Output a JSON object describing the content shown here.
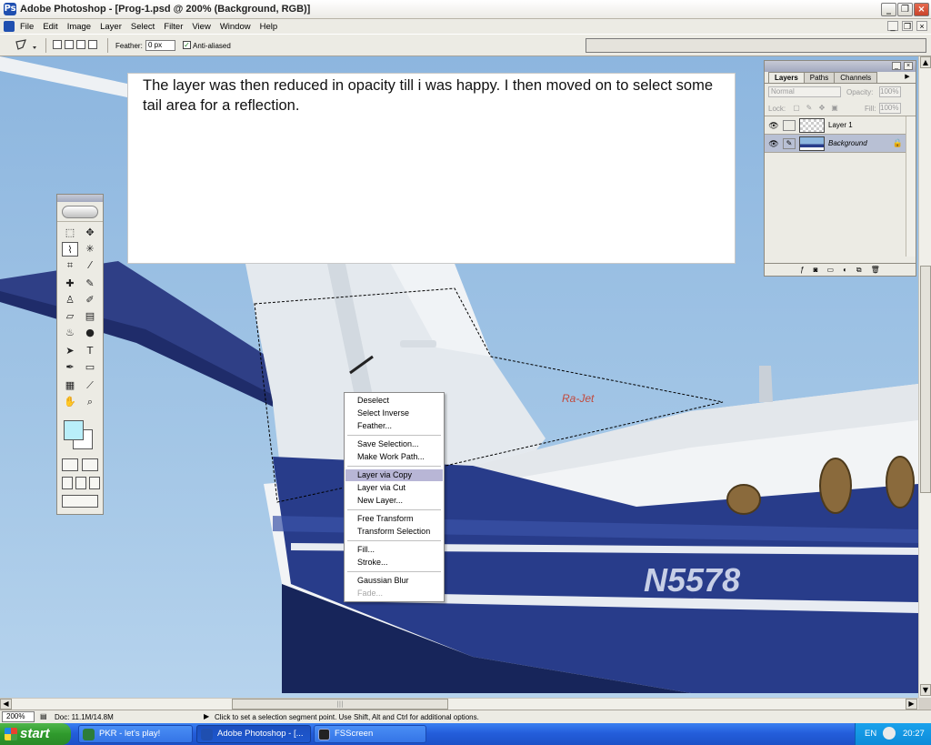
{
  "window": {
    "title": "Adobe Photoshop - [Prog-1.psd @ 200% (Background, RGB)]",
    "min_icon": "minimize-icon",
    "max_icon": "maximize-icon",
    "close_icon": "close-icon"
  },
  "menubar": {
    "items": [
      "File",
      "Edit",
      "Image",
      "Layer",
      "Select",
      "Filter",
      "View",
      "Window",
      "Help"
    ]
  },
  "options": {
    "feather_label": "Feather:",
    "feather_value": "0 px",
    "antialias_label": "Anti-aliased",
    "antialias_checked": true
  },
  "note": {
    "text": "The layer was then reduced in opacity till i was happy. I then moved on to select some tail area for a reflection."
  },
  "canvas": {
    "registration": "N5578",
    "tail_logo": "Ra-Jet"
  },
  "toolbox": {
    "foreground_color": "#b9eef9",
    "background_color": "#ffffff",
    "active_tool": "polygonal-lasso"
  },
  "layers_panel": {
    "tabs": [
      "Layers",
      "Paths",
      "Channels"
    ],
    "active_tab": "Layers",
    "blend_mode": "Normal",
    "opacity_label": "Opacity:",
    "opacity_value": "100%",
    "lock_label": "Lock:",
    "fill_label": "Fill:",
    "fill_value": "100%",
    "layers": [
      {
        "name": "Layer 1",
        "visible": true,
        "selected": false
      },
      {
        "name": "Background",
        "visible": true,
        "selected": true
      }
    ]
  },
  "context_menu": {
    "items": [
      {
        "label": "Deselect"
      },
      {
        "label": "Select Inverse"
      },
      {
        "label": "Feather..."
      },
      {
        "label": "Save Selection..."
      },
      {
        "label": "Make Work Path..."
      },
      {
        "label": "Layer via Copy",
        "highlighted": true
      },
      {
        "label": "Layer via Cut"
      },
      {
        "label": "New Layer..."
      },
      {
        "label": "Free Transform"
      },
      {
        "label": "Transform Selection"
      },
      {
        "label": "Fill..."
      },
      {
        "label": "Stroke..."
      },
      {
        "label": "Gaussian Blur"
      },
      {
        "label": "Fade...",
        "disabled": true
      }
    ]
  },
  "statusbar": {
    "zoom": "200%",
    "doc": "Doc: 11.1M/14.8M",
    "message": "Click to set a selection segment point.  Use Shift, Alt and Ctrl for additional options."
  },
  "taskbar": {
    "start_label": "start",
    "tasks": [
      {
        "label": "PKR - let's play!",
        "active": false
      },
      {
        "label": "Adobe Photoshop - [...",
        "active": true
      },
      {
        "label": "FSScreen",
        "active": false
      }
    ],
    "lang": "EN",
    "clock": "20:27"
  }
}
